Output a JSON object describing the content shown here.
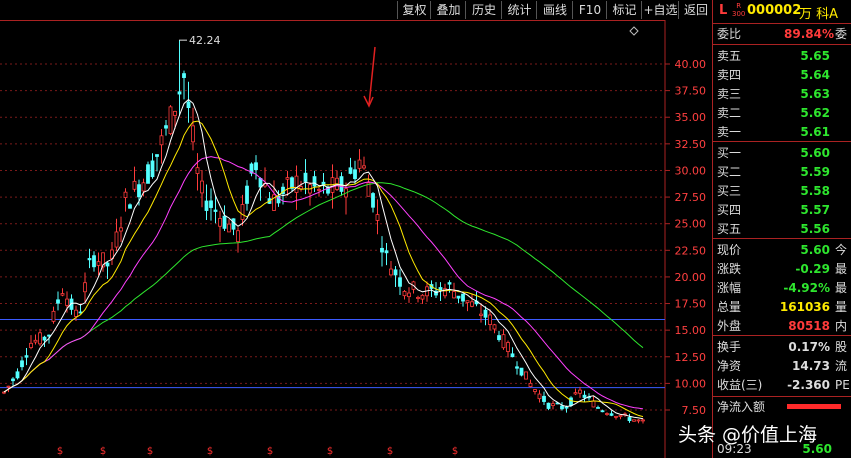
{
  "toolbar": {
    "buttons": [
      "复权",
      "叠加",
      "历史",
      "统计",
      "画线",
      "F10",
      "标记",
      "+自选",
      "返回"
    ]
  },
  "chart": {
    "high_label": "42.24",
    "y_ticks": [
      "40.00",
      "37.50",
      "35.00",
      "32.50",
      "30.00",
      "27.50",
      "25.00",
      "22.50",
      "20.00",
      "17.50",
      "15.00",
      "12.50",
      "10.00",
      "7.50"
    ],
    "marker_glyph": "$"
  },
  "chart_data": {
    "type": "candlestick",
    "ylim": [
      6,
      44
    ],
    "y_ticks": [
      40,
      37.5,
      35,
      32.5,
      30,
      27.5,
      25,
      22.5,
      20,
      17.5,
      15,
      12.5,
      10,
      7.5
    ],
    "high": 42.24,
    "colors": {
      "up": "#ff3b3b",
      "down": "#54ffff",
      "ma5": "#ffffff",
      "ma10": "#ffea00",
      "ma20": "#ff40ff",
      "ma60": "#2ee62e"
    }
  },
  "stock": {
    "flag": "L",
    "market_badge": "R\n300",
    "code": "000002",
    "name": "万 科A"
  },
  "quote": {
    "webi_label": "委比",
    "webi_value": "89.84%",
    "webi_tail": "委",
    "sells": [
      {
        "label": "卖五",
        "price": "5.65"
      },
      {
        "label": "卖四",
        "price": "5.64"
      },
      {
        "label": "卖三",
        "price": "5.63"
      },
      {
        "label": "卖二",
        "price": "5.62"
      },
      {
        "label": "卖一",
        "price": "5.61"
      }
    ],
    "buys": [
      {
        "label": "买一",
        "price": "5.60"
      },
      {
        "label": "买二",
        "price": "5.59"
      },
      {
        "label": "买三",
        "price": "5.58"
      },
      {
        "label": "买四",
        "price": "5.57"
      },
      {
        "label": "买五",
        "price": "5.56"
      }
    ],
    "stats": [
      {
        "label": "现价",
        "value": "5.60",
        "tail": "今",
        "color": "green"
      },
      {
        "label": "涨跌",
        "value": "-0.29",
        "tail": "最",
        "color": "green"
      },
      {
        "label": "涨幅",
        "value": "-4.92%",
        "tail": "最",
        "color": "green"
      },
      {
        "label": "总量",
        "value": "161036",
        "tail": "量",
        "color": "yellow"
      },
      {
        "label": "外盘",
        "value": "80518",
        "tail": "内",
        "color": "red"
      }
    ],
    "stats2": [
      {
        "label": "换手",
        "value": "0.17%",
        "tail": "股"
      },
      {
        "label": "净资",
        "value": "14.73",
        "tail": "流"
      },
      {
        "label": "收益(三)",
        "value": "-2.360",
        "tail": "PE"
      }
    ],
    "netflow_label": "净流入额",
    "time": "09:23",
    "time_price": "5.60"
  },
  "watermark": "头条 @价值上海"
}
